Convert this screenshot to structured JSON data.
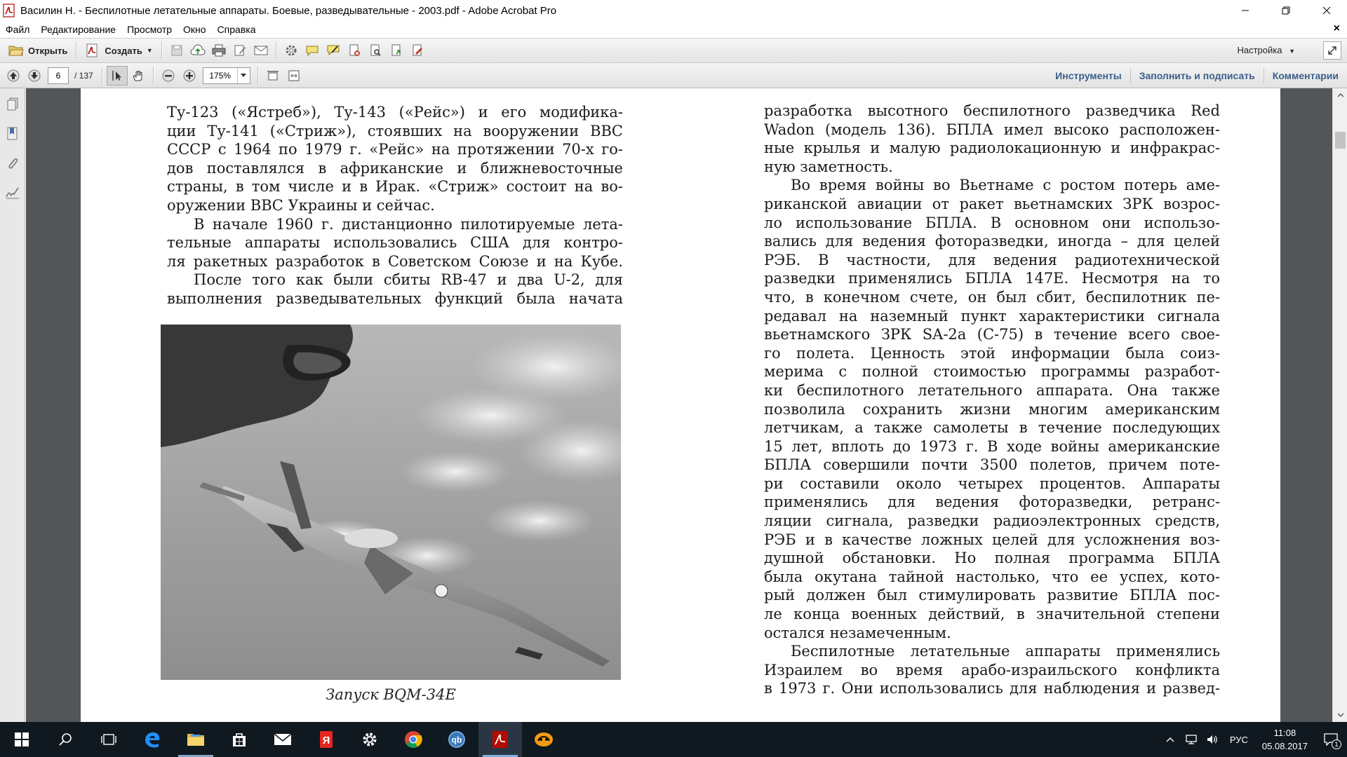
{
  "window": {
    "title": "Василин Н. -  Беспилотные летательные аппараты. Боевые, разведывательные - 2003.pdf - Adobe Acrobat Pro"
  },
  "menu": {
    "items": [
      "Файл",
      "Редактирование",
      "Просмотр",
      "Окно",
      "Справка"
    ]
  },
  "toolbar": {
    "open_label": "Открыть",
    "create_label": "Создать",
    "settings_label": "Настройка"
  },
  "nav": {
    "current_page": "6",
    "total_pages": "/ 137",
    "zoom": "175%"
  },
  "tabs": {
    "tools": "Инструменты",
    "fill_sign": "Заполнить и подписать",
    "comments": "Комментарии"
  },
  "page": {
    "left_lines": [
      "Ту-123 («Ястреб»), Ту-143 («Рейс») и его модифика-",
      "ции Ту-141 («Стриж»), стоявших на вооружении ВВС",
      "СССР с 1964 по 1979 г. «Рейс» на протяжении 70-х го-",
      "дов поставлялся в африканские и ближневосточные",
      "страны, в том числе и в Ирак. «Стриж» состоит на во-",
      "оружении ВВС Украины и сейчас.",
      "В начале 1960 г. дистанционно пилотируемые лета-",
      "тельные аппараты использовались США для контро-",
      "ля ракетных разработок в Советском Союзе и на Кубе.",
      "После того  как были сбиты RB-47 и два U-2, для",
      "выполнения разведывательных функций была начата"
    ],
    "right_lines": [
      "разработка высотного беспилотного разведчика Red",
      "Wadon (модель 136). БПЛА имел высоко расположен-",
      "ные крылья и малую радиолокационную и инфракрас-",
      "ную заметность.",
      "Во время войны во Вьетнаме с ростом потерь аме-",
      "риканской авиации от ракет вьетнамских ЗРК возрос-",
      "ло использование БПЛА. В основном они использо-",
      "вались для ведения фоторазведки, иногда – для целей",
      "РЭБ. В частности, для ведения радиотехнической",
      "разведки применялись БПЛА 147Е. Несмотря на то",
      "что, в конечном счете, он был сбит, беспилотник пе-",
      "редавал на наземный пункт характеристики сигнала",
      "вьетнамского ЗРК SA-2а (С-75) в течение всего свое-",
      "го полета. Ценность этой информации была соиз-",
      "мерима с полной стоимостью программы разработ-",
      "ки беспилотного летательного аппарата. Она также",
      "позволила сохранить жизни многим американским",
      "летчикам, а также самолеты в течение последующих",
      "15 лет, вплоть до 1973 г. В ходе войны американские",
      "БПЛА совершили почти 3500 полетов, причем поте-",
      "ри составили около четырех процентов. Аппараты",
      "применялись для ведения фоторазведки, ретранс-",
      "ляции сигнала, разведки радиоэлектронных средств,",
      "РЭБ и в качестве ложных целей для усложнения воз-",
      "душной обстановки. Но полная программа БПЛА",
      "была окутана тайной настолько, что ее успех, кото-",
      "рый должен был стимулировать развитие БПЛА пос-",
      "ле конца военных действий, в значительной степени",
      "остался незамеченным.",
      "Беспилотные летательные аппараты применялись",
      "Израилем во время арабо-израильского конфликта",
      "в 1973 г. Они использовались для наблюдения и развед-"
    ],
    "caption": "Запуск  BQM-34E"
  },
  "taskbar": {
    "language": "РУС",
    "time": "11:08",
    "date": "05.08.2017",
    "notification_count": "1"
  }
}
